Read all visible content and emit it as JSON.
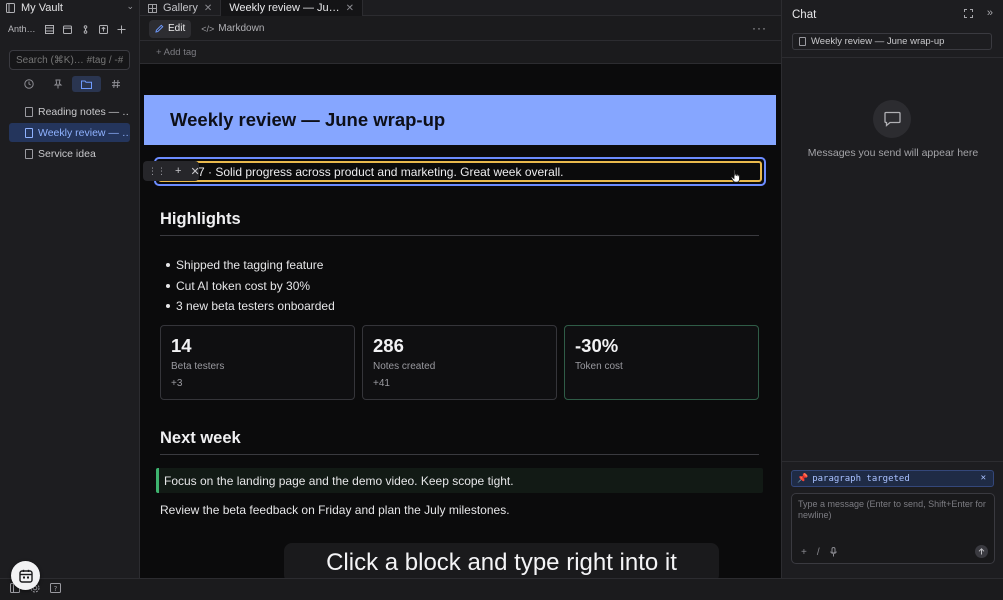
{
  "sidebar": {
    "vault_name": "My Vault",
    "tools_label": "Anth…",
    "search_placeholder": "Search (⌘K)… #tag / -#e",
    "files": [
      {
        "label": "Reading notes — …",
        "active": false
      },
      {
        "label": "Weekly review — …",
        "active": true
      },
      {
        "label": "Service idea",
        "active": false
      }
    ]
  },
  "tabs": [
    {
      "label": "Gallery",
      "active": false
    },
    {
      "label": "Weekly review — Ju…",
      "active": true
    }
  ],
  "editor": {
    "mode_edit": "Edit",
    "mode_markdown": "Markdown",
    "more": "···",
    "add_tag": "+ Add tag"
  },
  "document": {
    "title": "Weekly review — June wrap-up",
    "intro": "7 · Solid progress across product and marketing. Great week overall.",
    "highlights_heading": "Highlights",
    "highlights": [
      "Shipped the tagging feature",
      "Cut AI token cost by 30%",
      "3 new beta testers onboarded"
    ],
    "cards": [
      {
        "value": "14",
        "label": "Beta testers",
        "delta": "+3"
      },
      {
        "value": "286",
        "label": "Notes created",
        "delta": "+41"
      },
      {
        "value": "-30%",
        "label": "Token cost",
        "delta": ""
      }
    ],
    "next_heading": "Next week",
    "callout": "Focus on the landing page and the demo video. Keep scope tight.",
    "next_para": "Review the beta feedback on Friday and plan the July milestones."
  },
  "caption": "Click a block and type right into it",
  "chat": {
    "title": "Chat",
    "context_file": "Weekly review — June wrap-up",
    "empty_message": "Messages you send will appear here",
    "target_chip": "paragraph targeted",
    "input_placeholder": "Type a message (Enter to send, Shift+Enter for newline)"
  },
  "colors": {
    "title_block": "#86a6ff",
    "selection_outer": "#6c8cff",
    "selection_inner": "#e9b94d",
    "callout_accent": "#3eb36f",
    "active_item": "#24355c"
  }
}
